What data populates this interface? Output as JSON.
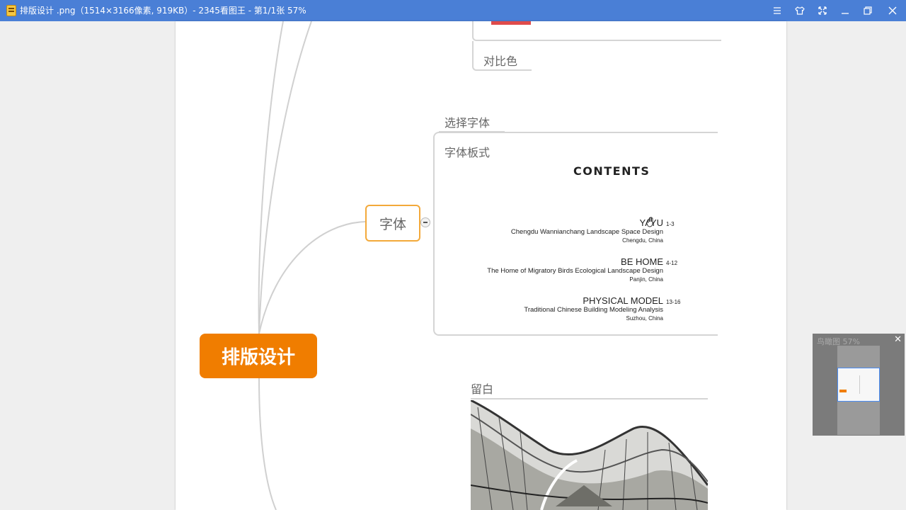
{
  "titlebar": {
    "title": "排版设计 .png（1514×3166像素, 919KB）- 2345看图王 - 第1/1张 57%",
    "buttons": [
      "menu-icon",
      "skin-icon",
      "fullscreen-icon",
      "minimize-icon",
      "restore-icon",
      "close-icon"
    ],
    "color": "#4a7fd6"
  },
  "mindmap": {
    "root": "排版设计",
    "topic": "字体",
    "contrast_label": "对比色",
    "select_font_label": "选择字体",
    "font_layout_label": "字体板式",
    "whitespace_label": "留白",
    "root_color": "#f07d00",
    "topic_border_color": "#f3a93a"
  },
  "contents": {
    "title": "CONTENTS",
    "entries": [
      {
        "title": "YAYU",
        "range": "1-3",
        "subtitle": "Chengdu Wannianchang Landscape Space Design",
        "location": "Chengdu, China"
      },
      {
        "title": "BE HOME",
        "range": "4-12",
        "subtitle": "The Home of Migratory Birds Ecological Landscape Design",
        "location": "Panjin, China"
      },
      {
        "title": "PHYSICAL MODEL",
        "range": "13-16",
        "subtitle": "Traditional Chinese Building Modeling Analysis",
        "location": "Suzhou, China"
      }
    ]
  },
  "navigator": {
    "title": "鸟瞰图 57%",
    "close": "✕"
  }
}
